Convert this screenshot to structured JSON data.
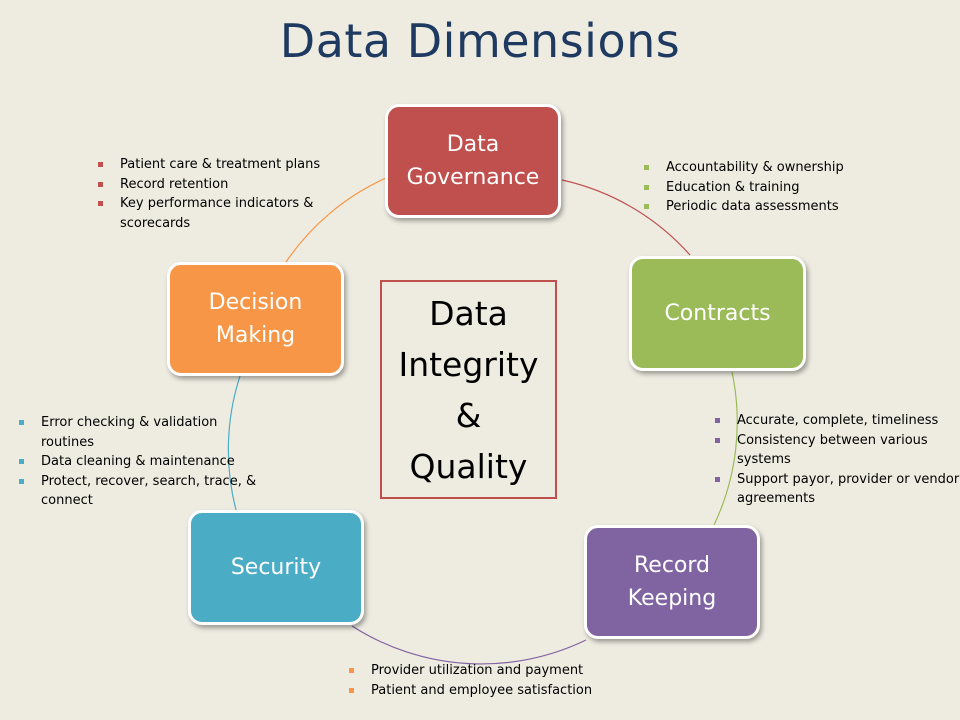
{
  "title": "Data Dimensions",
  "center_text": "Data\nIntegrity\n&\nQuality",
  "colors": {
    "background": "#eeece1",
    "title": "#1f3a60",
    "data_governance": "#c0504d",
    "contracts": "#9bbb59",
    "record_keeping": "#8064a2",
    "security": "#4bacc6",
    "decision_making": "#f79646"
  },
  "nodes": {
    "data_governance": {
      "label": "Data\nGovernance",
      "bullets": [
        "Accountability & ownership",
        "Education & training",
        "Periodic data assessments"
      ]
    },
    "contracts": {
      "label": "Contracts",
      "bullets": [
        "Accurate, complete, timeliness",
        "Consistency between various systems",
        "Support payor, provider or vendor agreements"
      ]
    },
    "record_keeping": {
      "label": "Record\nKeeping",
      "bullets": [
        "Provider utilization and payment",
        "Patient and employee satisfaction"
      ]
    },
    "security": {
      "label": "Security",
      "bullets": [
        "Error checking & validation routines",
        "Data cleaning & maintenance",
        "Protect, recover, search, trace, & connect"
      ]
    },
    "decision_making": {
      "label": "Decision\nMaking",
      "bullets": [
        "Patient care & treatment plans",
        "Record retention",
        "Key performance indicators & scorecards"
      ]
    }
  }
}
